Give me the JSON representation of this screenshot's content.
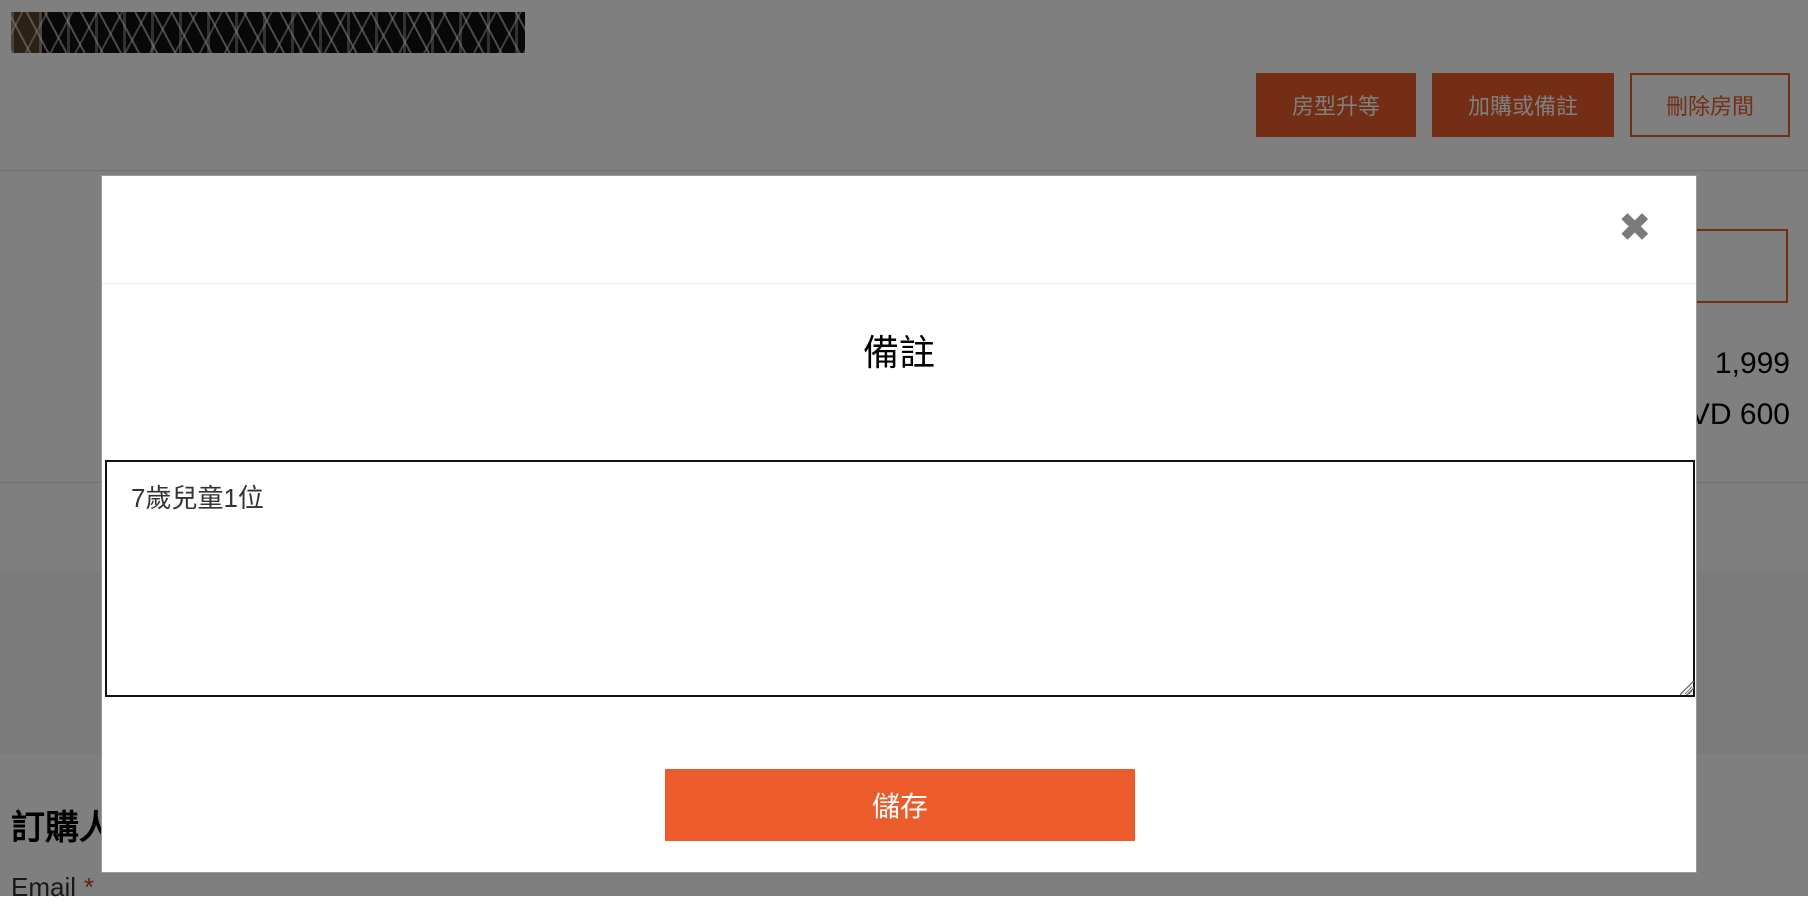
{
  "background": {
    "room_actions": {
      "upgrade_label": "房型升等",
      "addon_label": "加購或備註",
      "remove_label": "刪除房間"
    },
    "prices": [
      "1,999",
      "VD 600"
    ],
    "section_title": "訂購人",
    "email_label": "Email",
    "required_mark": "*"
  },
  "modal": {
    "close_icon": "close-icon",
    "title": "備註",
    "note_value": "7歲兒童1位",
    "save_label": "儲存"
  },
  "colors": {
    "accent": "#ec5b2b",
    "overlay": "rgba(0,0,0,0.5)"
  }
}
